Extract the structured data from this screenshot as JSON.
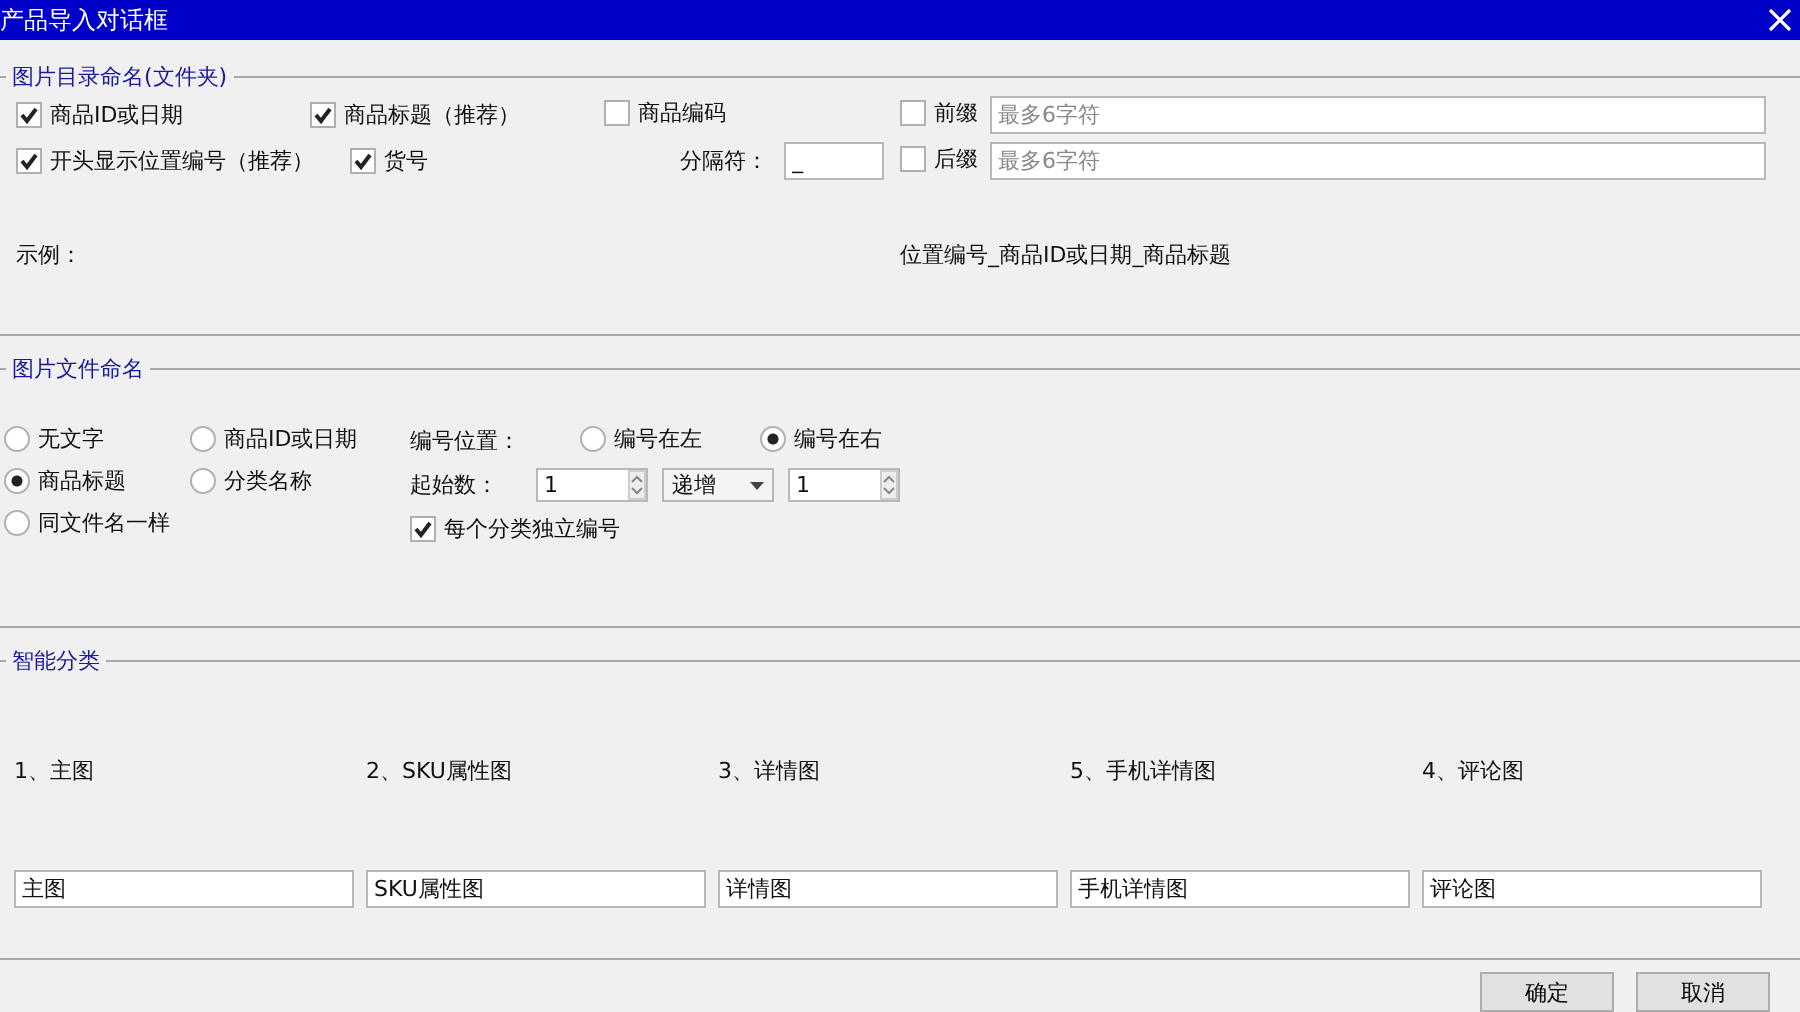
{
  "window": {
    "title": "产品导入对话框"
  },
  "folder_naming": {
    "legend": "图片目录命名(文件夹)",
    "options": [
      {
        "label": "商品ID或日期",
        "checked": true
      },
      {
        "label": "商品标题（推荐）",
        "checked": true
      },
      {
        "label": "商品编码",
        "checked": false
      },
      {
        "label": "开头显示位置编号（推荐）",
        "checked": true
      },
      {
        "label": "货号",
        "checked": true
      }
    ],
    "separator": {
      "label": "分隔符：",
      "value": "_"
    },
    "prefix": {
      "label": "前缀",
      "checked": false,
      "placeholder": "最多6字符"
    },
    "suffix": {
      "label": "后缀",
      "checked": false,
      "placeholder": "最多6字符"
    },
    "example_label": "示例：",
    "example": "位置编号_商品ID或日期_商品标题"
  },
  "file_naming": {
    "legend": "图片文件命名",
    "modes": [
      {
        "label": "无文字",
        "selected": false
      },
      {
        "label": "商品ID或日期",
        "selected": false
      },
      {
        "label": "商品标题",
        "selected": true
      },
      {
        "label": "分类名称",
        "selected": false
      },
      {
        "label": "同文件名一样",
        "selected": false
      }
    ],
    "position": {
      "label": "编号位置：",
      "options": [
        {
          "label": "编号在左",
          "selected": false
        },
        {
          "label": "编号在右",
          "selected": true
        }
      ]
    },
    "start": {
      "label": "起始数：",
      "value": "1",
      "order": "递增",
      "step": "1"
    },
    "independent": {
      "label": "每个分类独立编号",
      "checked": true
    }
  },
  "smart_category": {
    "legend": "智能分类",
    "items": [
      {
        "label": "1、主图",
        "value": "主图"
      },
      {
        "label": "2、SKU属性图",
        "value": "SKU属性图"
      },
      {
        "label": "3、详情图",
        "value": "详情图"
      },
      {
        "label": "5、手机详情图",
        "value": "手机详情图"
      },
      {
        "label": "4、评论图",
        "value": "评论图"
      }
    ]
  },
  "buttons": [
    "确定",
    "取消"
  ]
}
